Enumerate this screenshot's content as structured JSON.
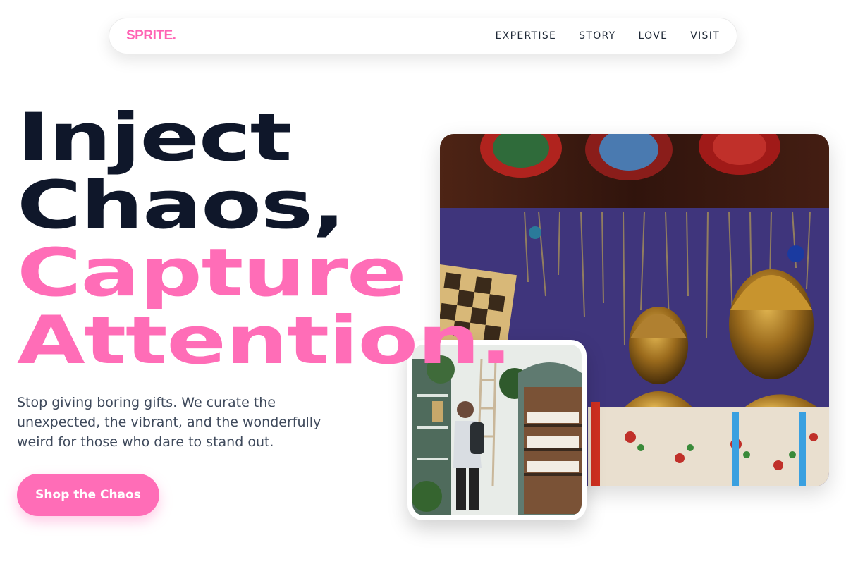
{
  "nav": {
    "logo": "SPRITE.",
    "links": [
      "EXPERTISE",
      "STORY",
      "LOVE",
      "VISIT"
    ]
  },
  "hero": {
    "headline": {
      "line1": "Inject",
      "line2": "Chaos,",
      "line3": "Capture",
      "line4": "Attention."
    },
    "subtext": "Stop giving boring gifts. We curate the unexpected, the vibrant, and the wonderfully weird for those who dare to stand out.",
    "cta_label": "Shop the Chaos"
  },
  "images": {
    "main": "market-stall-with-bronze-busts-photo",
    "secondary": "man-browsing-shop-shelves-photo"
  },
  "colors": {
    "accent": "#ff6db7",
    "dark": "#0f172a",
    "body_text": "#3f4a5c"
  }
}
